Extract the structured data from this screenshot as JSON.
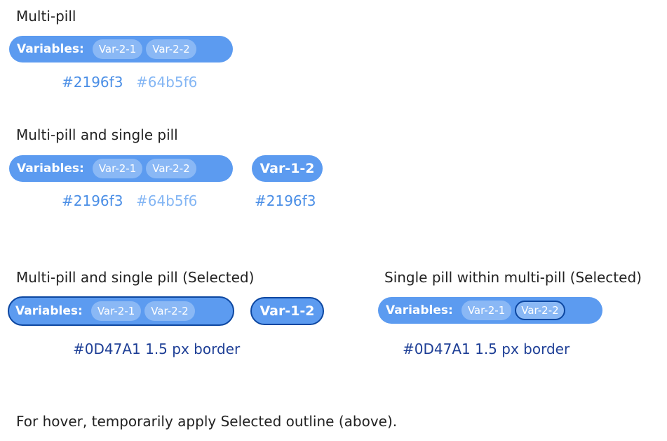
{
  "colors": {
    "pill_fill": "#5c9bf0",
    "chip_fill": "#8ab8f5",
    "primary_label": "#2196f3",
    "secondary_label": "#64b5f6",
    "selected_border": "#0d47a1"
  },
  "section1": {
    "heading": "Multi-pill",
    "multi": {
      "label": "Variables:",
      "chips": [
        "Var-2-1",
        "Var-2-2"
      ]
    },
    "color_primary": "#2196f3",
    "color_secondary": "#64b5f6"
  },
  "section2": {
    "heading": "Multi-pill and single pill",
    "multi": {
      "label": "Variables:",
      "chips": [
        "Var-2-1",
        "Var-2-2"
      ]
    },
    "single": "Var-1-2",
    "color_primary": "#2196f3",
    "color_secondary": "#64b5f6",
    "single_color": "#2196f3"
  },
  "section3": {
    "heading": "Multi-pill and single pill (Selected)",
    "multi": {
      "label": "Variables:",
      "chips": [
        "Var-2-1",
        "Var-2-2"
      ]
    },
    "single": "Var-1-2",
    "note": "#0D47A1 1.5 px border"
  },
  "section4": {
    "heading": "Single pill within multi-pill (Selected)",
    "multi": {
      "label": "Variables:",
      "chips": [
        "Var-2-1",
        "Var-2-2"
      ]
    },
    "note": "#0D47A1 1.5 px border"
  },
  "footer": "For hover, temporarily apply Selected outline (above)."
}
